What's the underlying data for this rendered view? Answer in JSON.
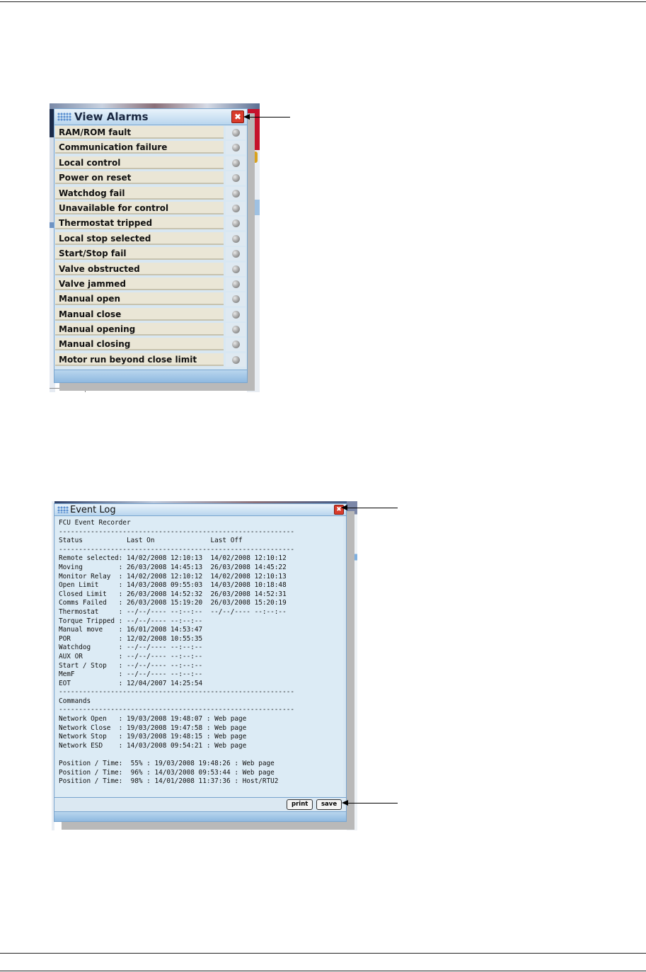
{
  "alarms_window": {
    "title": "View Alarms",
    "close_label": "✖",
    "items": [
      "RAM/ROM fault",
      "Communication failure",
      "Local control",
      "Power on reset",
      "Watchdog fail",
      "Unavailable for control",
      "Thermostat tripped",
      "Local stop selected",
      "Start/Stop fail",
      "Valve obstructed",
      "Valve jammed",
      "Manual open",
      "Manual close",
      "Manual opening",
      "Manual closing",
      "Motor run beyond close limit"
    ]
  },
  "event_log_window": {
    "title": "Event Log",
    "close_label": "✖",
    "content": "FCU Event Recorder\n-----------------------------------------------------------\nStatus           Last On              Last Off\n-----------------------------------------------------------\nRemote selected: 14/02/2008 12:10:13  14/02/2008 12:10:12\nMoving         : 26/03/2008 14:45:13  26/03/2008 14:45:22\nMonitor Relay  : 14/02/2008 12:10:12  14/02/2008 12:10:13\nOpen Limit     : 14/03/2008 09:55:03  14/03/2008 10:18:48\nClosed Limit   : 26/03/2008 14:52:32  26/03/2008 14:52:31\nComms Failed   : 26/03/2008 15:19:20  26/03/2008 15:20:19\nThermostat     : --/--/---- --:--:--  --/--/---- --:--:--\nTorque Tripped : --/--/---- --:--:--\nManual move    : 16/01/2008 14:53:47\nPOR            : 12/02/2008 10:55:35\nWatchdog       : --/--/---- --:--:--\nAUX OR         : --/--/---- --:--:--\nStart / Stop   : --/--/---- --:--:--\nMemF           : --/--/---- --:--:--\nEOT            : 12/04/2007 14:25:54\n-----------------------------------------------------------\nCommands\n-----------------------------------------------------------\nNetwork Open   : 19/03/2008 19:48:07 : Web page\nNetwork Close  : 19/03/2008 19:47:58 : Web page\nNetwork Stop   : 19/03/2008 19:48:15 : Web page\nNetwork ESD    : 14/03/2008 09:54:21 : Web page\n\nPosition / Time:  55% : 19/03/2008 19:48:26 : Web page\nPosition / Time:  96% : 14/03/2008 09:53:44 : Web page\nPosition / Time:  98% : 14/01/2008 11:37:36 : Host/RTU2",
    "buttons": {
      "print": "print",
      "save": "save"
    }
  }
}
